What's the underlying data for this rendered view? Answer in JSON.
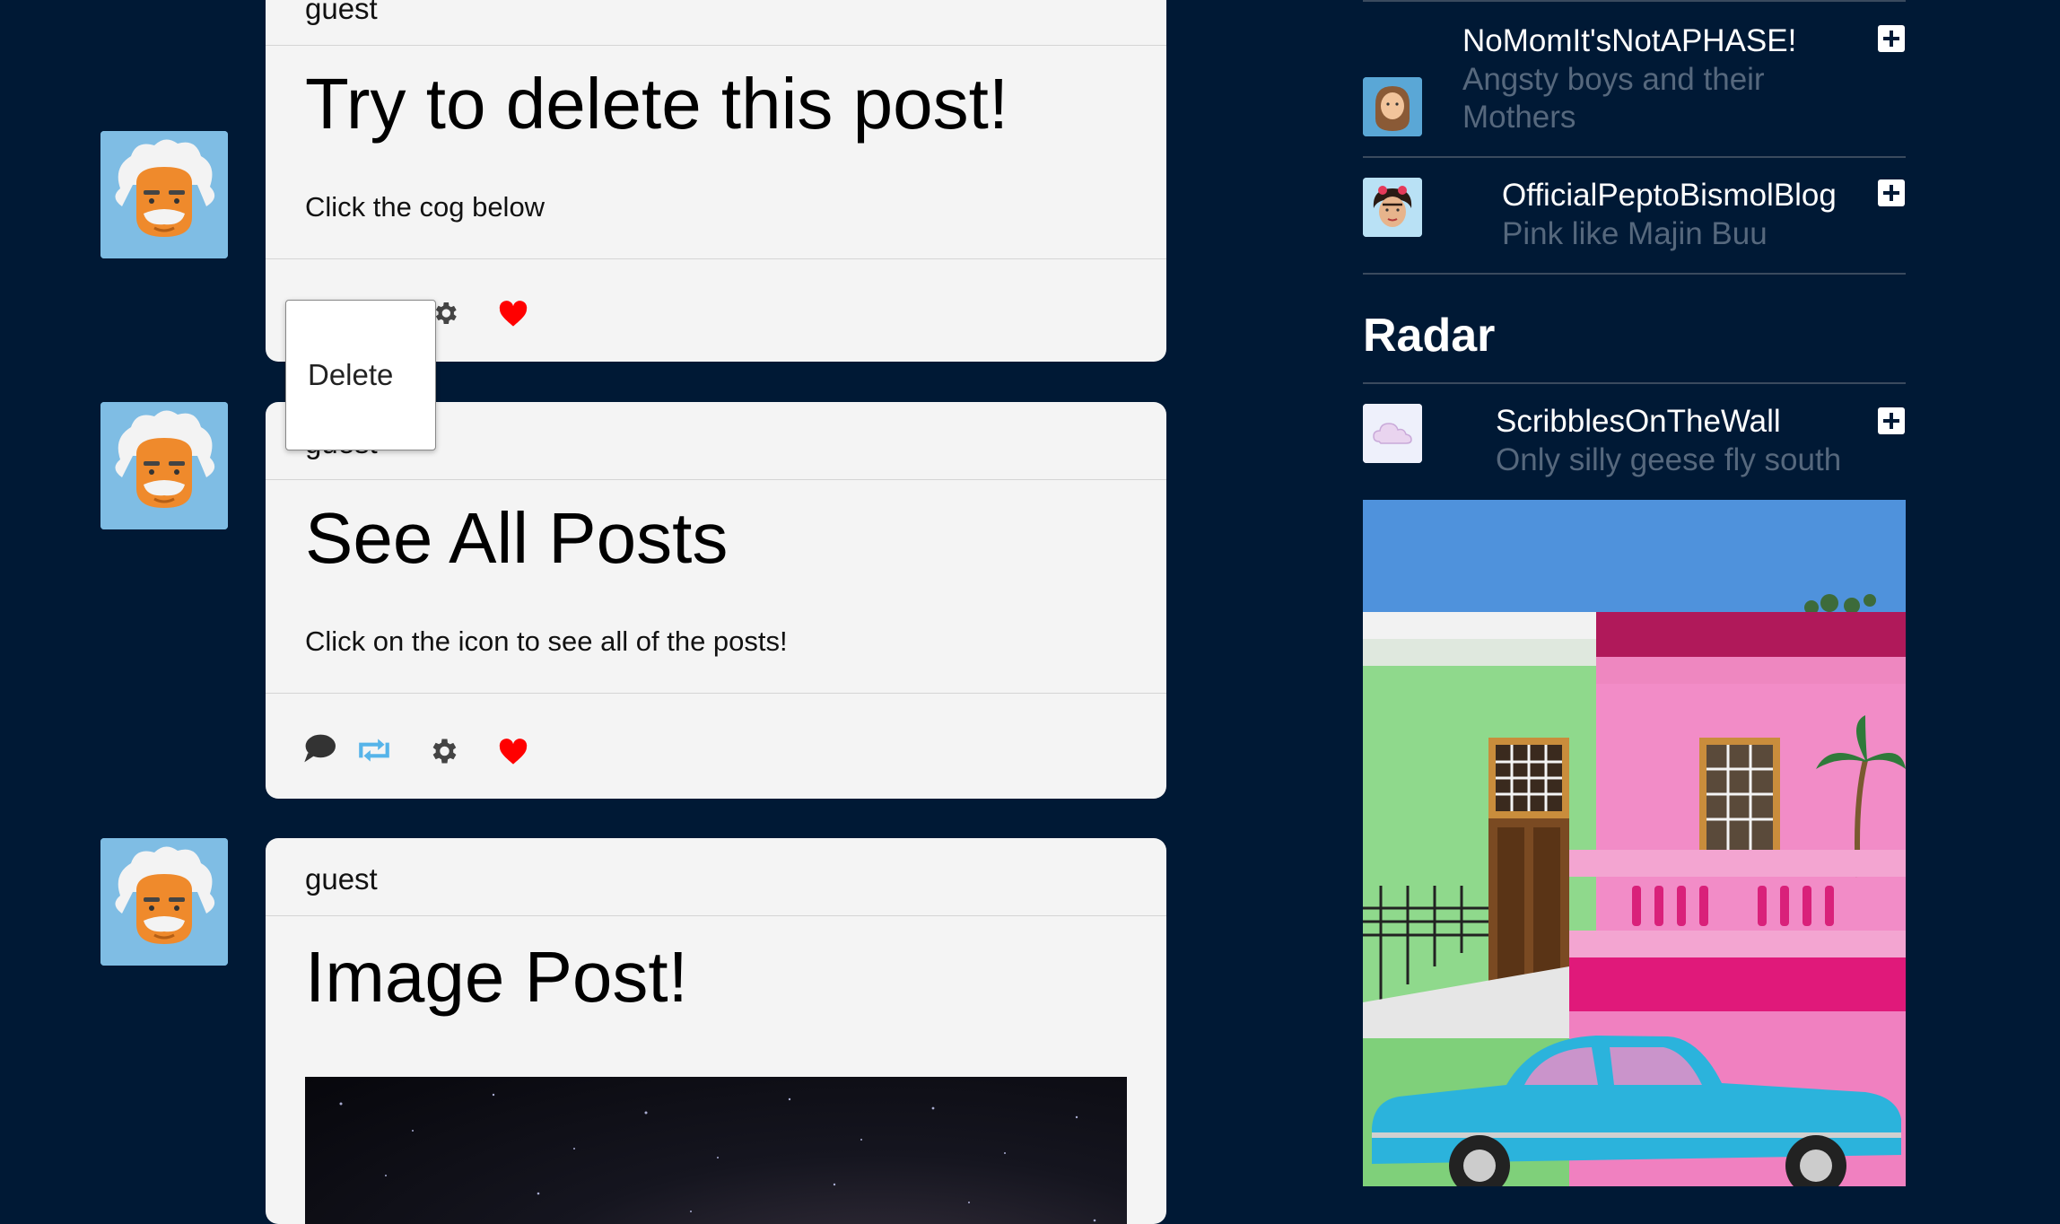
{
  "posts": [
    {
      "author": "guest",
      "title": "Try to delete this post!",
      "body": "Click the cog below"
    },
    {
      "author": "guest",
      "title": "See All Posts",
      "body": "Click on the icon to see all of the posts!"
    },
    {
      "author": "guest",
      "title": "Image Post!"
    }
  ],
  "popup": {
    "delete_label": "Delete"
  },
  "sidebar": {
    "blogs": [
      {
        "name": "NoMomIt'sNotAPHASE!",
        "description": "Angsty boys and their Mothers"
      },
      {
        "name": "OfficialPeptoBismolBlog",
        "description": "Pink like Majin Buu"
      }
    ],
    "radar_title": "Radar",
    "radar": {
      "name": "ScribblesOnTheWall",
      "description": "Only silly geese fly south"
    }
  },
  "colors": {
    "background": "#001935",
    "card": "#f4f4f4",
    "heart": "#ff0000",
    "reblog": "#56b4e9",
    "muted_text": "#56687d"
  },
  "icons": [
    "comment-icon",
    "reblog-icon",
    "gear-icon",
    "heart-icon",
    "plus-square-icon"
  ]
}
